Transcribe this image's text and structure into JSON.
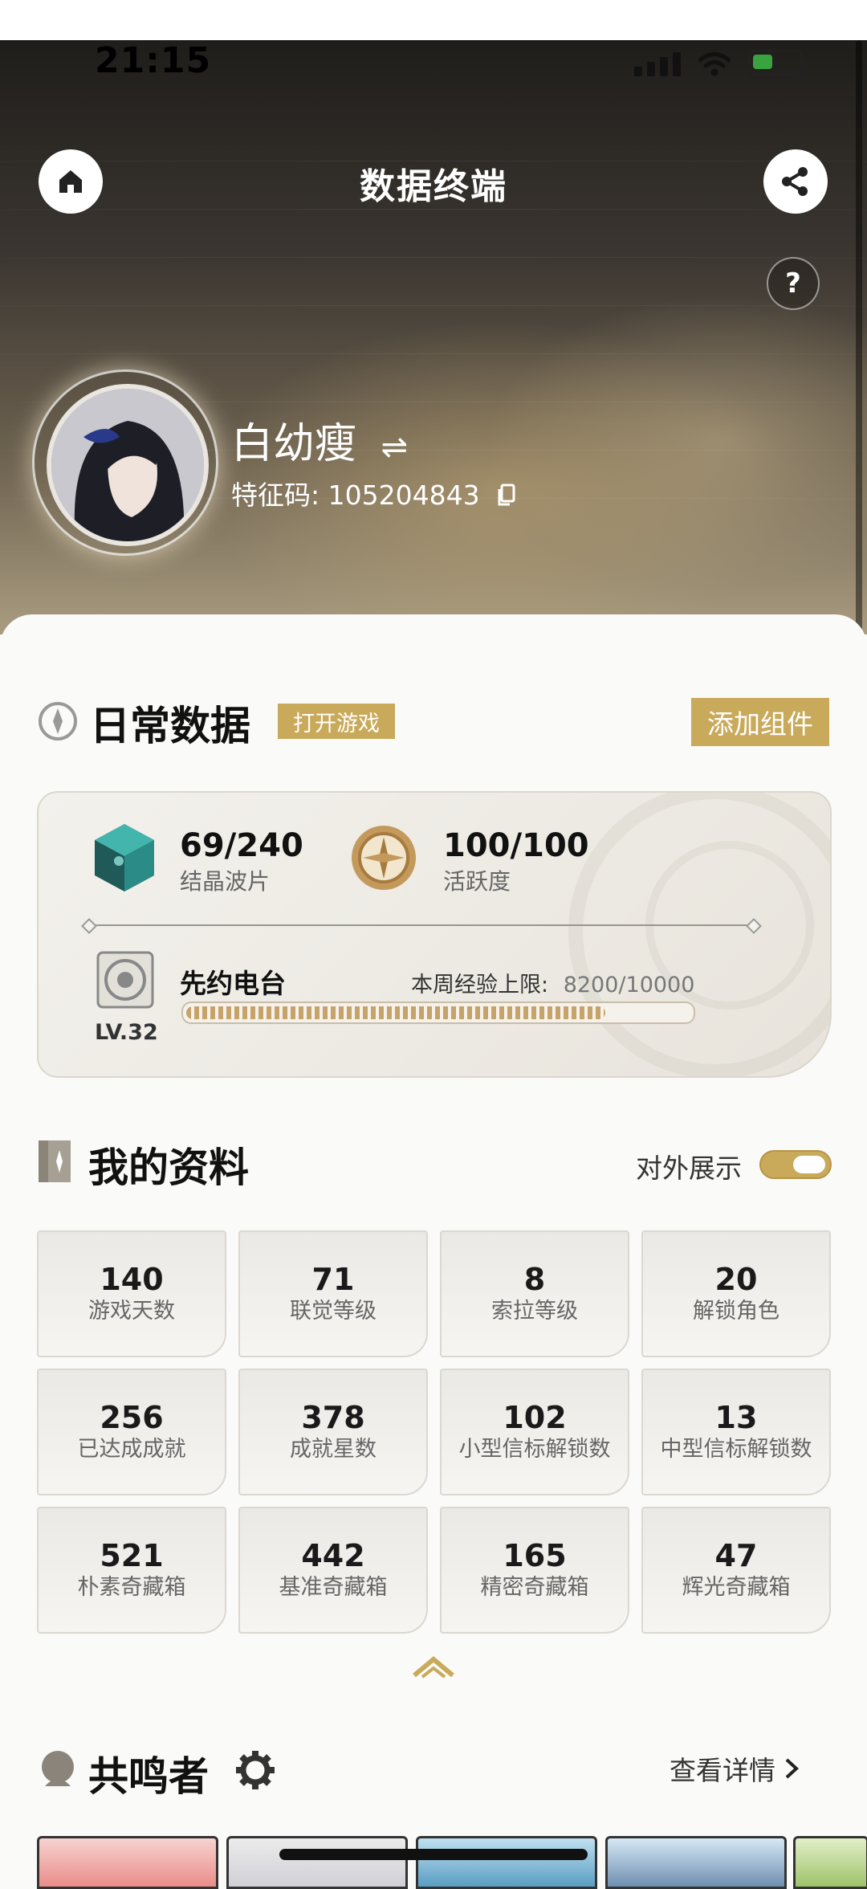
{
  "status_bar": {
    "time": "21:15"
  },
  "header": {
    "title": "数据终端",
    "help": "?"
  },
  "profile": {
    "name": "白幼瘦",
    "swap_icon": "⇌",
    "id_label": "特征码: 105204843"
  },
  "daily": {
    "title": "日常数据",
    "open_game": "打开游戏",
    "add_widget": "添加组件",
    "crystal": {
      "value": "69/240",
      "label": "结晶波片"
    },
    "activity": {
      "value": "100/100",
      "label": "活跃度"
    },
    "radio": {
      "name": "先约电台",
      "level": "LV.32",
      "weekly_label": "本周经验上限:",
      "weekly_value": "8200/10000",
      "progress": 0.82
    }
  },
  "profile_data": {
    "title": "我的资料",
    "public_label": "对外展示",
    "stats": [
      {
        "value": "140",
        "label": "游戏天数"
      },
      {
        "value": "71",
        "label": "联觉等级"
      },
      {
        "value": "8",
        "label": "索拉等级"
      },
      {
        "value": "20",
        "label": "解锁角色"
      },
      {
        "value": "256",
        "label": "已达成成就"
      },
      {
        "value": "378",
        "label": "成就星数"
      },
      {
        "value": "102",
        "label": "小型信标解锁数"
      },
      {
        "value": "13",
        "label": "中型信标解锁数"
      },
      {
        "value": "521",
        "label": "朴素奇藏箱"
      },
      {
        "value": "442",
        "label": "基准奇藏箱"
      },
      {
        "value": "165",
        "label": "精密奇藏箱"
      },
      {
        "value": "47",
        "label": "辉光奇藏箱"
      }
    ]
  },
  "resonators": {
    "title": "共鸣者",
    "view_details": "查看详情"
  },
  "colors": {
    "accent": "#c9a95a",
    "text": "#1a1a1a",
    "muted": "#666666"
  },
  "icons": [
    "home-icon",
    "share-icon",
    "help-icon",
    "swap-icon",
    "copy-icon",
    "daily-data-icon",
    "crystal-icon",
    "compass-icon",
    "radio-icon",
    "profile-icon",
    "resonator-icon",
    "gear-icon",
    "chevron-up-icon",
    "chevron-right-icon"
  ]
}
